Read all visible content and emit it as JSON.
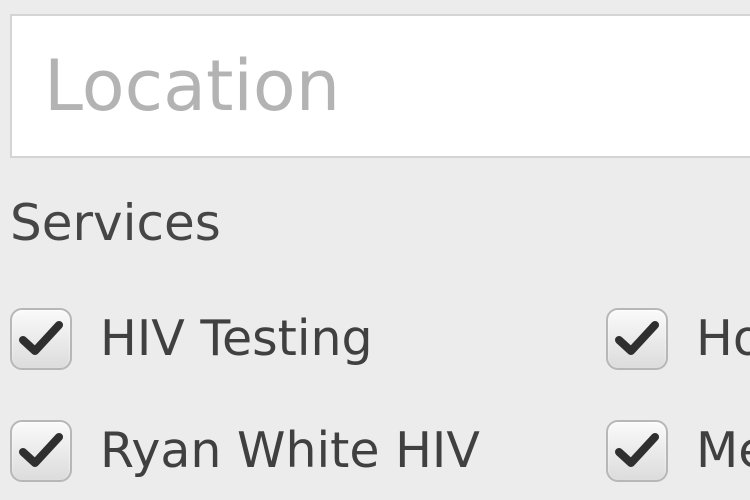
{
  "location": {
    "placeholder": "Location",
    "value": ""
  },
  "services": {
    "heading": "Services",
    "options": [
      {
        "label": "HIV Testing",
        "checked": true
      },
      {
        "label": "Ho",
        "checked": true
      },
      {
        "label": "Ryan White HIV",
        "checked": true
      },
      {
        "label": "Me",
        "checked": true
      }
    ]
  },
  "icons": {
    "checkbox_mark": "checkmark-icon"
  }
}
